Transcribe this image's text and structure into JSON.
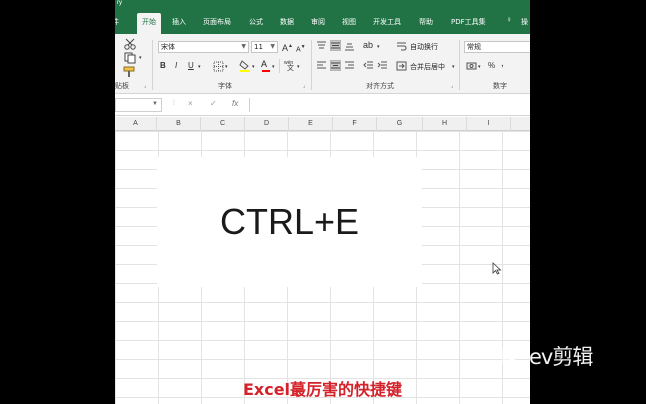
{
  "window": {
    "top_edge_text": "ry"
  },
  "ribbon": {
    "tabs": [
      {
        "label": "件",
        "cut": true
      },
      {
        "label": "开始",
        "active": true
      },
      {
        "label": "插入"
      },
      {
        "label": "页面布局"
      },
      {
        "label": "公式"
      },
      {
        "label": "数据"
      },
      {
        "label": "审阅"
      },
      {
        "label": "视图"
      },
      {
        "label": "开发工具"
      },
      {
        "label": "帮助"
      },
      {
        "label": "PDF工具集"
      }
    ],
    "share_label": "操",
    "clipboard_label": "贴板",
    "font": {
      "name": "宋体",
      "size": "11",
      "grow_label": "A",
      "shrink_label": "A",
      "bold": "B",
      "italic": "I",
      "underline": "U",
      "font_color_letter": "A",
      "wen_label": "wén",
      "group_label": "字体"
    },
    "alignment": {
      "wrap_label": "自动换行",
      "merge_label": "合并后居中",
      "group_label": "对齐方式"
    },
    "number": {
      "format": "常规",
      "percent": "%",
      "comma": ",",
      "group_label": "数字"
    },
    "colors": {
      "brand": "#217346",
      "fill_highlight": "#ffff00",
      "font_color": "#ff0000"
    }
  },
  "formula_bar": {
    "cancel": "×",
    "enter": "✓",
    "fx": "fx"
  },
  "grid": {
    "columns": [
      "A",
      "B",
      "C",
      "D",
      "E",
      "F",
      "G",
      "H",
      "I"
    ]
  },
  "card": {
    "text": "CTRL+E"
  },
  "caption": {
    "text": "Excel蕞厉害的快捷键",
    "color": "#d4222a"
  },
  "watermark": {
    "text": "ev剪辑"
  }
}
